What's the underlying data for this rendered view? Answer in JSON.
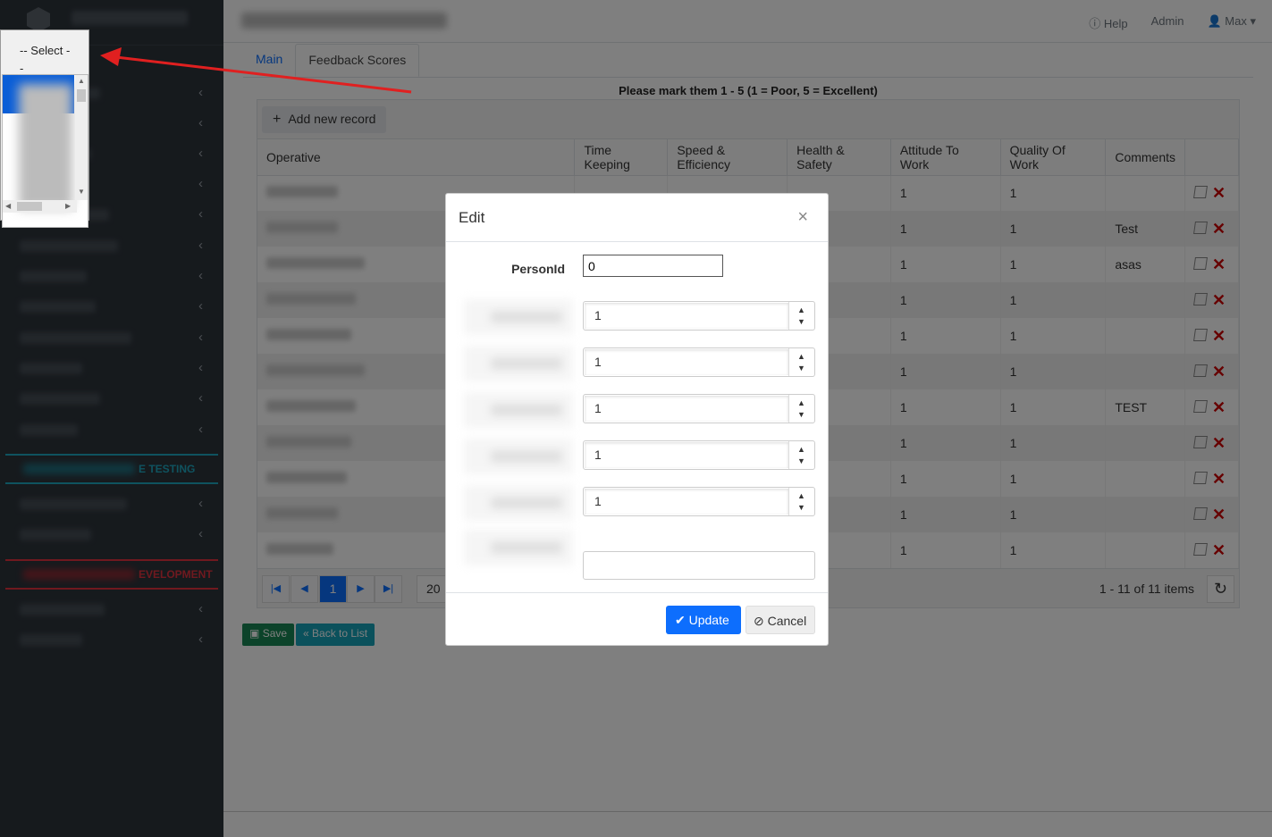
{
  "topbar": {
    "help": "Help",
    "admin": "Admin",
    "user": "Max"
  },
  "tabs": {
    "main": "Main",
    "feedback": "Feedback Scores"
  },
  "grid": {
    "title": "Please mark them 1 - 5 (1 = Poor, 5 = Excellent)",
    "add_label": "Add new record",
    "columns": [
      "Operative",
      "Time Keeping",
      "Speed & Efficiency",
      "Health & Safety",
      "Attitude To Work",
      "Quality Of Work",
      "Comments"
    ],
    "rows": [
      {
        "attitude": "1",
        "quality": "1",
        "comments": ""
      },
      {
        "attitude": "1",
        "quality": "1",
        "comments": "Test"
      },
      {
        "attitude": "1",
        "quality": "1",
        "comments": "asas"
      },
      {
        "attitude": "1",
        "quality": "1",
        "comments": ""
      },
      {
        "attitude": "1",
        "quality": "1",
        "comments": ""
      },
      {
        "attitude": "1",
        "quality": "1",
        "comments": ""
      },
      {
        "attitude": "1",
        "quality": "1",
        "comments": "TEST"
      },
      {
        "attitude": "1",
        "quality": "1",
        "comments": ""
      },
      {
        "attitude": "1",
        "quality": "1",
        "comments": ""
      },
      {
        "attitude": "1",
        "quality": "1",
        "comments": ""
      },
      {
        "attitude": "1",
        "quality": "1",
        "comments": ""
      }
    ],
    "pager": {
      "current_page": "1",
      "page_size": "20",
      "info": "1 - 11 of 11 items"
    }
  },
  "buttons": {
    "save": "Save",
    "back": "Back to List"
  },
  "sidebar": {
    "section_testing": "E TESTING",
    "section_dev": "EVELOPMENT"
  },
  "modal": {
    "title": "Edit",
    "close": "×",
    "person_label": "PersonId",
    "person_value": "0",
    "steppers": [
      "1",
      "1",
      "1",
      "1",
      "1"
    ],
    "comments_value": "",
    "update": "Update",
    "cancel": "Cancel"
  },
  "dropdown": {
    "text": "-- Select --"
  },
  "colors": {
    "primary": "#0d6efd",
    "delete": "#cc0000",
    "arrow": "#e02020"
  }
}
